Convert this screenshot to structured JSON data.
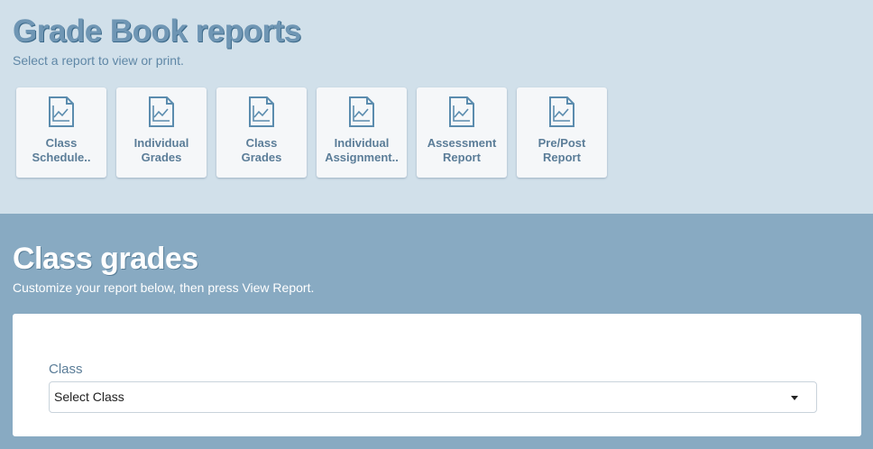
{
  "header": {
    "title": "Grade Book reports",
    "subtitle": "Select a report to view or print."
  },
  "reports": [
    {
      "line1": "Class",
      "line2": "Schedule..",
      "icon": "report-chart-icon"
    },
    {
      "line1": "Individual",
      "line2": "Grades",
      "icon": "report-chart-icon"
    },
    {
      "line1": "Class",
      "line2": "Grades",
      "icon": "report-chart-icon"
    },
    {
      "line1": "Individual",
      "line2": "Assignment..",
      "icon": "report-chart-icon"
    },
    {
      "line1": "Assessment",
      "line2": "Report",
      "icon": "report-chart-icon"
    },
    {
      "line1": "Pre/Post",
      "line2": "Report",
      "icon": "report-chart-icon"
    }
  ],
  "section": {
    "title": "Class grades",
    "subtitle": "Customize your report below, then press View Report."
  },
  "form": {
    "class_label": "Class",
    "class_select_value": "Select Class"
  },
  "colors": {
    "top_bg": "#d1e0ea",
    "bottom_bg": "#88aac2",
    "accent": "#5b7d98"
  }
}
